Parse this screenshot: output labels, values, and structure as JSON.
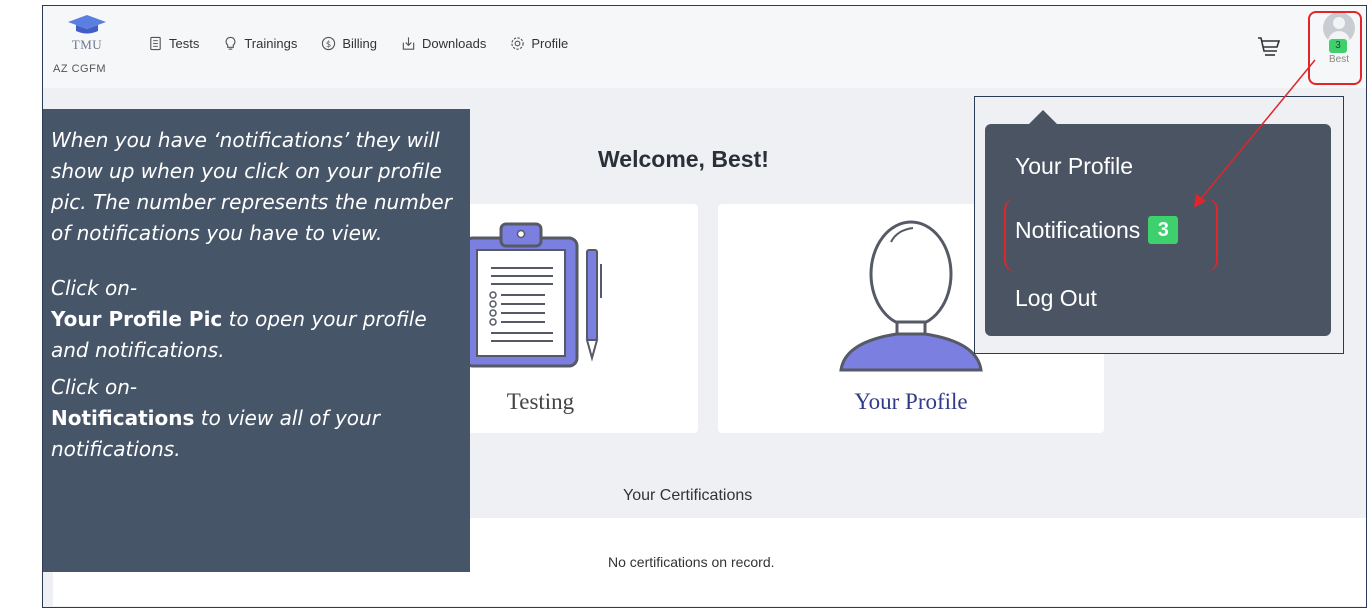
{
  "brand": {
    "logo_text": "TMU",
    "org": "AZ CGFM"
  },
  "nav": {
    "items": [
      {
        "label": "Tests",
        "icon": "document-icon"
      },
      {
        "label": "Trainings",
        "icon": "lightbulb-icon"
      },
      {
        "label": "Billing",
        "icon": "dollar-icon"
      },
      {
        "label": "Downloads",
        "icon": "download-icon"
      },
      {
        "label": "Profile",
        "icon": "gear-icon"
      }
    ]
  },
  "user": {
    "name": "Best",
    "notification_count": "3"
  },
  "main": {
    "welcome": "Welcome, Best!",
    "cards": {
      "testing": "Testing",
      "profile": "Your Profile"
    },
    "certifications_title": "Your Certifications",
    "certifications_empty": "No certifications on record."
  },
  "dropdown": {
    "profile": "Your Profile",
    "notifications": "Notifications",
    "notifications_count": "3",
    "logout": "Log Out"
  },
  "note": {
    "intro": "When you have ‘notifications’ they will show up when you click on your profile pic.  The number represents the number of notifications you have to view.",
    "click1": "Click on-",
    "bold1": "Your Profile Pic",
    "desc1": " to open your profile and notifications.",
    "click2": "Click on-",
    "bold2": "Notifications",
    "desc2": " to view all of your notifications."
  },
  "colors": {
    "note_bg": "#475569",
    "menu_bg": "#4b5462",
    "badge_green": "#3ed06c",
    "annotation_red": "#e0262b",
    "accent_purple": "#7b7fe0"
  }
}
